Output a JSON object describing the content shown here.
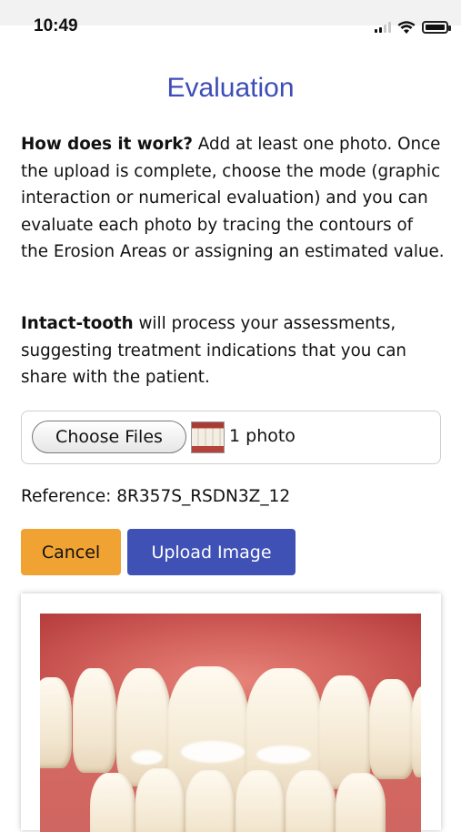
{
  "status_bar": {
    "time": "10:49"
  },
  "page": {
    "title": "Evaluation"
  },
  "intro": {
    "heading": "How does it work?",
    "text": " Add at least one photo. Once the upload is complete, choose the mode (graphic interaction or numerical evaluation) and you can evaluate each photo by tracing the contours of the Erosion Areas or assigning an estimated value."
  },
  "info": {
    "brand": "Intact-tooth",
    "text": " will process your assessments, suggesting treatment indications that you can share with the patient."
  },
  "file_input": {
    "button_label": "Choose Files",
    "count_label": "1 photo"
  },
  "reference": {
    "text": "Reference: 8R357S_RSDN3Z_12"
  },
  "actions": {
    "cancel_label": "Cancel",
    "upload_label": "Upload Image"
  },
  "colors": {
    "accent": "#3f51b5",
    "title": "#3d4db8",
    "cancel": "#f0a233"
  }
}
